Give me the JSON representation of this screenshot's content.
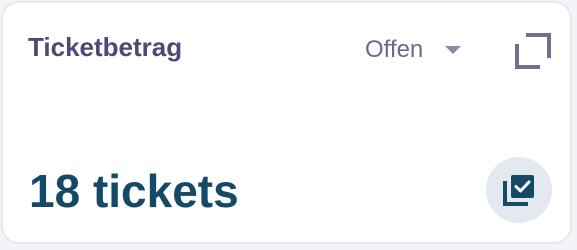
{
  "card": {
    "title": "Ticketbetrag",
    "filter": {
      "selected": "Offen",
      "icon": "chevron-down-icon"
    },
    "expand_icon": "expand-icon",
    "value": "18 tickets",
    "badge_icon": "ticket-check-icon"
  },
  "colors": {
    "title": "#4a4a78",
    "value": "#154a66",
    "icon": "#154a66",
    "badge_background": "#e4e9ef",
    "card_border": "#e7e7ef"
  }
}
